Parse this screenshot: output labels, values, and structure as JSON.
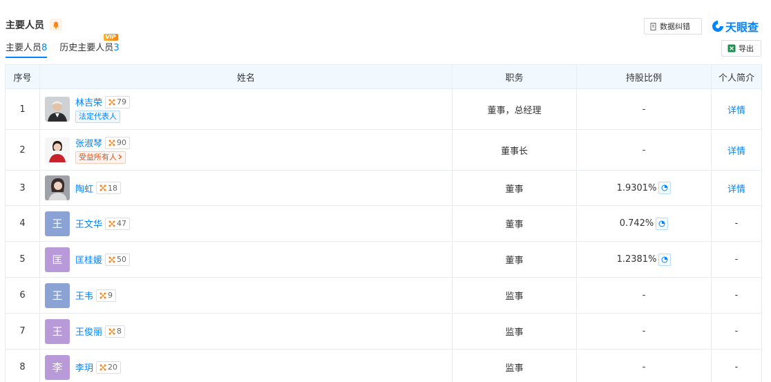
{
  "header": {
    "title": "主要人员",
    "correct_label": "数据纠错",
    "export_label": "导出",
    "logo_text": "天眼查"
  },
  "tabs": [
    {
      "label": "主要人员",
      "count": "8",
      "active": true
    },
    {
      "label": "历史主要人员",
      "count": "3",
      "badge": "VIP"
    }
  ],
  "table": {
    "columns": [
      "序号",
      "姓名",
      "职务",
      "持股比例",
      "个人简介"
    ],
    "rows": [
      {
        "index": "1",
        "name": "林吉荣",
        "score": "79",
        "tag": "法定代表人",
        "title": "董事，总经理",
        "ratio": "-",
        "profile": "详情"
      },
      {
        "index": "2",
        "name": "张淑琴",
        "score": "90",
        "tag": "受益所有人",
        "title": "董事长",
        "ratio": "-",
        "profile": "详情"
      },
      {
        "index": "3",
        "name": "陶虹",
        "score": "18",
        "title": "董事",
        "ratio": "1.9301%",
        "profile": "详情"
      },
      {
        "index": "4",
        "name": "王文华",
        "initial": "王",
        "score": "47",
        "title": "董事",
        "ratio": "0.742%",
        "profile": "-"
      },
      {
        "index": "5",
        "name": "匡桂媛",
        "initial": "匡",
        "score": "50",
        "title": "董事",
        "ratio": "1.2381%",
        "profile": "-"
      },
      {
        "index": "6",
        "name": "王韦",
        "initial": "王",
        "score": "9",
        "title": "监事",
        "ratio": "-",
        "profile": "-"
      },
      {
        "index": "7",
        "name": "王俊丽",
        "initial": "王",
        "score": "8",
        "title": "监事",
        "ratio": "-",
        "profile": "-"
      },
      {
        "index": "8",
        "name": "李玥",
        "initial": "李",
        "score": "20",
        "title": "监事",
        "ratio": "-",
        "profile": "-"
      }
    ]
  },
  "colors": {
    "accent": "#0084ff",
    "header_bg": "#f2f9fe",
    "avatar_blue": "#8aa3d4",
    "avatar_purple": "#b99ad9"
  }
}
